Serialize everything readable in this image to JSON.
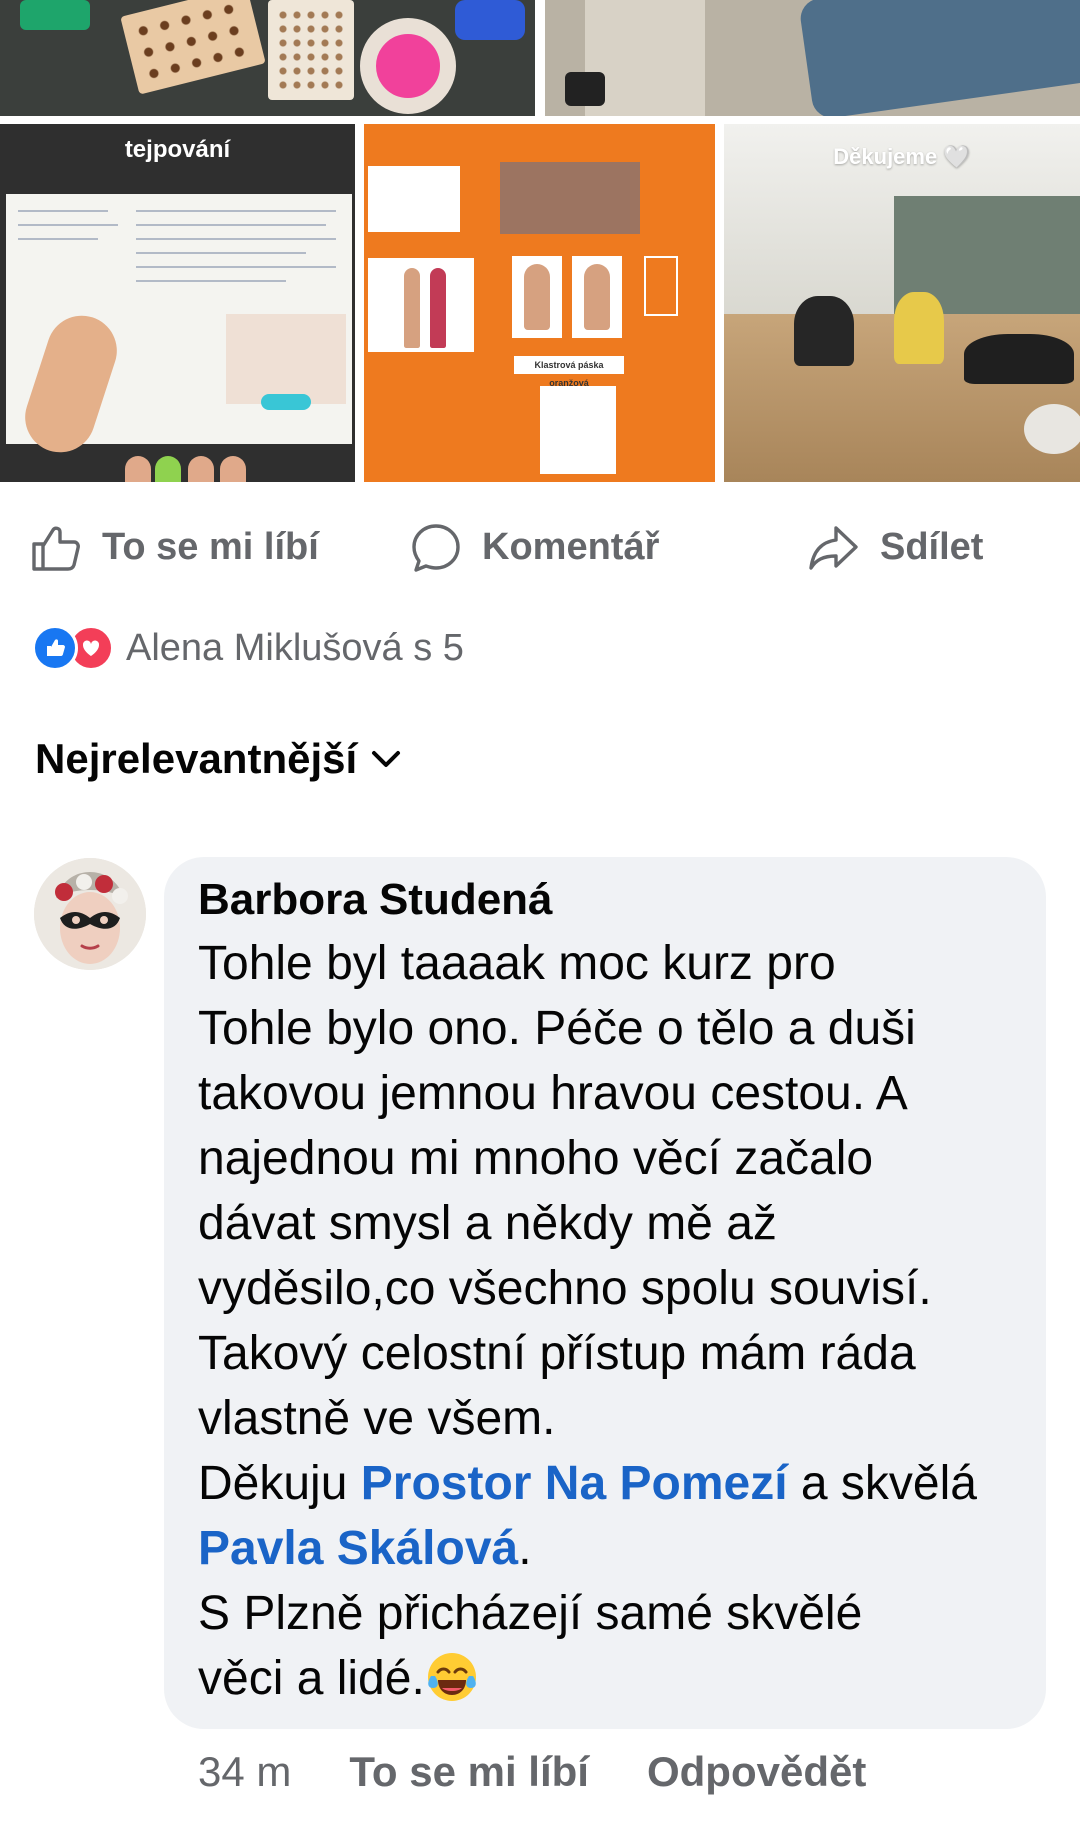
{
  "photos": {
    "poster_title": "tejpování",
    "klastr_label": "Klastrová páska oranžová",
    "thanks_text": "Děkujeme 🤍"
  },
  "actions": {
    "like_label": "To se mi líbí",
    "comment_label": "Komentář",
    "share_label": "Sdílet"
  },
  "reactions": {
    "text": "Alena Miklušová s 5"
  },
  "sort": {
    "label": "Nejrelevantnější"
  },
  "comment": {
    "author": "Barbora Studená",
    "lines": [
      "Tohle byl taaaak moc kurz pro",
      "Tohle bylo ono. Péče o tělo a duši",
      "takovou jemnou hravou cestou. A",
      "najednou mi mnoho věcí začalo",
      "dávat smysl a někdy mě až",
      "vyděsilo,co všechno spolu souvisí.",
      "Takový celostní přístup mám ráda",
      "vlastně ve všem."
    ],
    "thanks_prefix": "Děkuju ",
    "mention_1": "Prostor Na Pomezí",
    "thanks_middle": " a skvělá",
    "mention_2": "Pavla Skálová",
    "mention_2_suffix": ".",
    "closing_line_1": "S Plzně přicházejí samé skvělé",
    "closing_line_2": "věci a lidé.",
    "emoji": "face-with-tears-of-joy-icon",
    "time": "34 m",
    "like_label": "To se mi líbí",
    "reply_label": "Odpovědět"
  },
  "colors": {
    "secondary_text": "#65676b",
    "mention": "#1a64c7",
    "bubble": "#f0f2f5",
    "like_blue": "#1877f2",
    "love_red": "#f33e58"
  }
}
